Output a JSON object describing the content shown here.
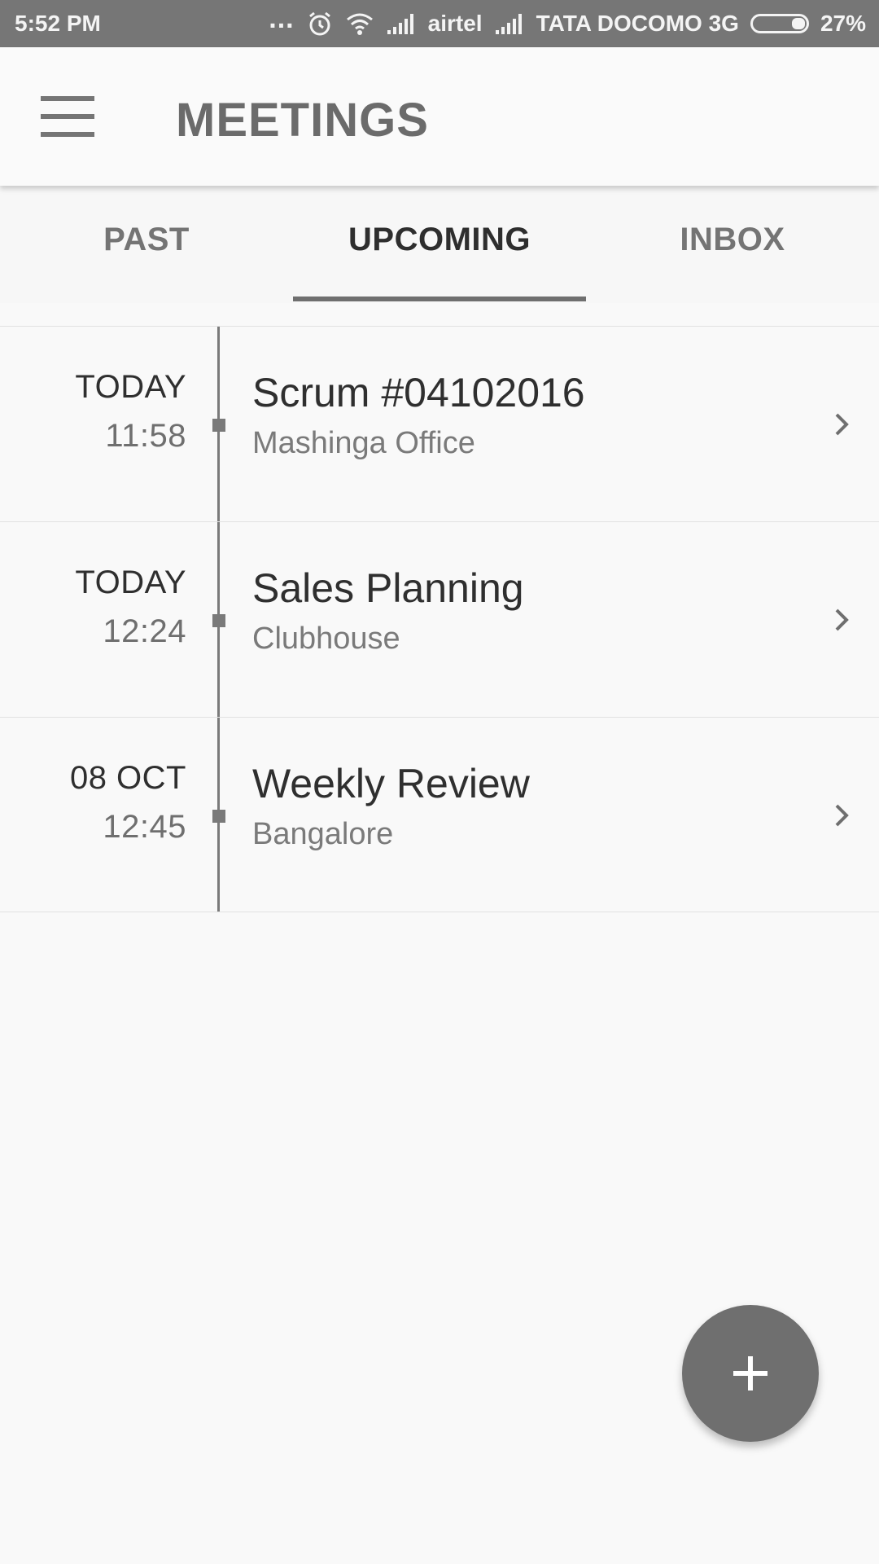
{
  "status_bar": {
    "time": "5:52 PM",
    "dots": "...",
    "carrier1": "airtel",
    "carrier2": "TATA DOCOMO 3G",
    "battery": "27%",
    "icons": [
      "alarm-icon",
      "wifi-icon",
      "signal-icon",
      "signal-icon",
      "battery-icon"
    ]
  },
  "app_bar": {
    "title": "MEETINGS",
    "menu_icon": "hamburger-menu-icon"
  },
  "tabs": [
    {
      "label": "PAST",
      "active": false
    },
    {
      "label": "UPCOMING",
      "active": true
    },
    {
      "label": "INBOX",
      "active": false
    }
  ],
  "meetings": [
    {
      "date": "TODAY",
      "time": "11:58",
      "title": "Scrum #04102016",
      "location": "Mashinga Office"
    },
    {
      "date": "TODAY",
      "time": "12:24",
      "title": "Sales Planning",
      "location": "Clubhouse"
    },
    {
      "date": "08 OCT",
      "time": "12:45",
      "title": "Weekly Review",
      "location": "Bangalore"
    }
  ],
  "fab": {
    "icon": "plus-icon"
  },
  "colors": {
    "status_bar": "#767676",
    "background": "#f9f9f9",
    "accent_gray": "#6f6f6f",
    "text_dark": "#2f2f2f",
    "text_muted": "#7a7a7a"
  }
}
